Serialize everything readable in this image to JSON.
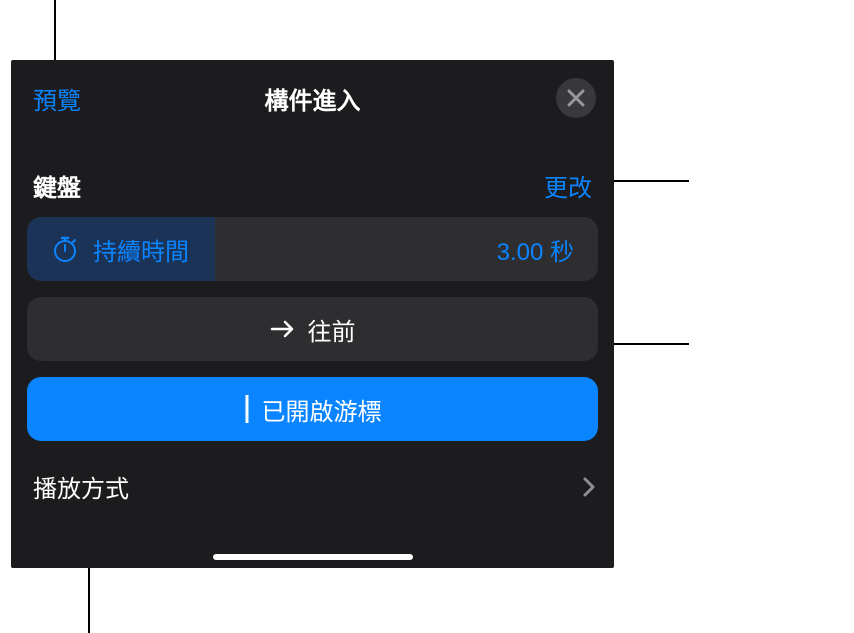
{
  "header": {
    "preview": "預覽",
    "title": "構件進入",
    "close_aria": "close"
  },
  "section": {
    "label": "鍵盤",
    "change": "更改"
  },
  "duration": {
    "label": "持續時間",
    "value": "3.00 秒",
    "progress_percent": 33
  },
  "direction": {
    "label": "往前"
  },
  "cursor": {
    "label": "已開啟游標"
  },
  "delivery": {
    "label": "播放方式"
  }
}
